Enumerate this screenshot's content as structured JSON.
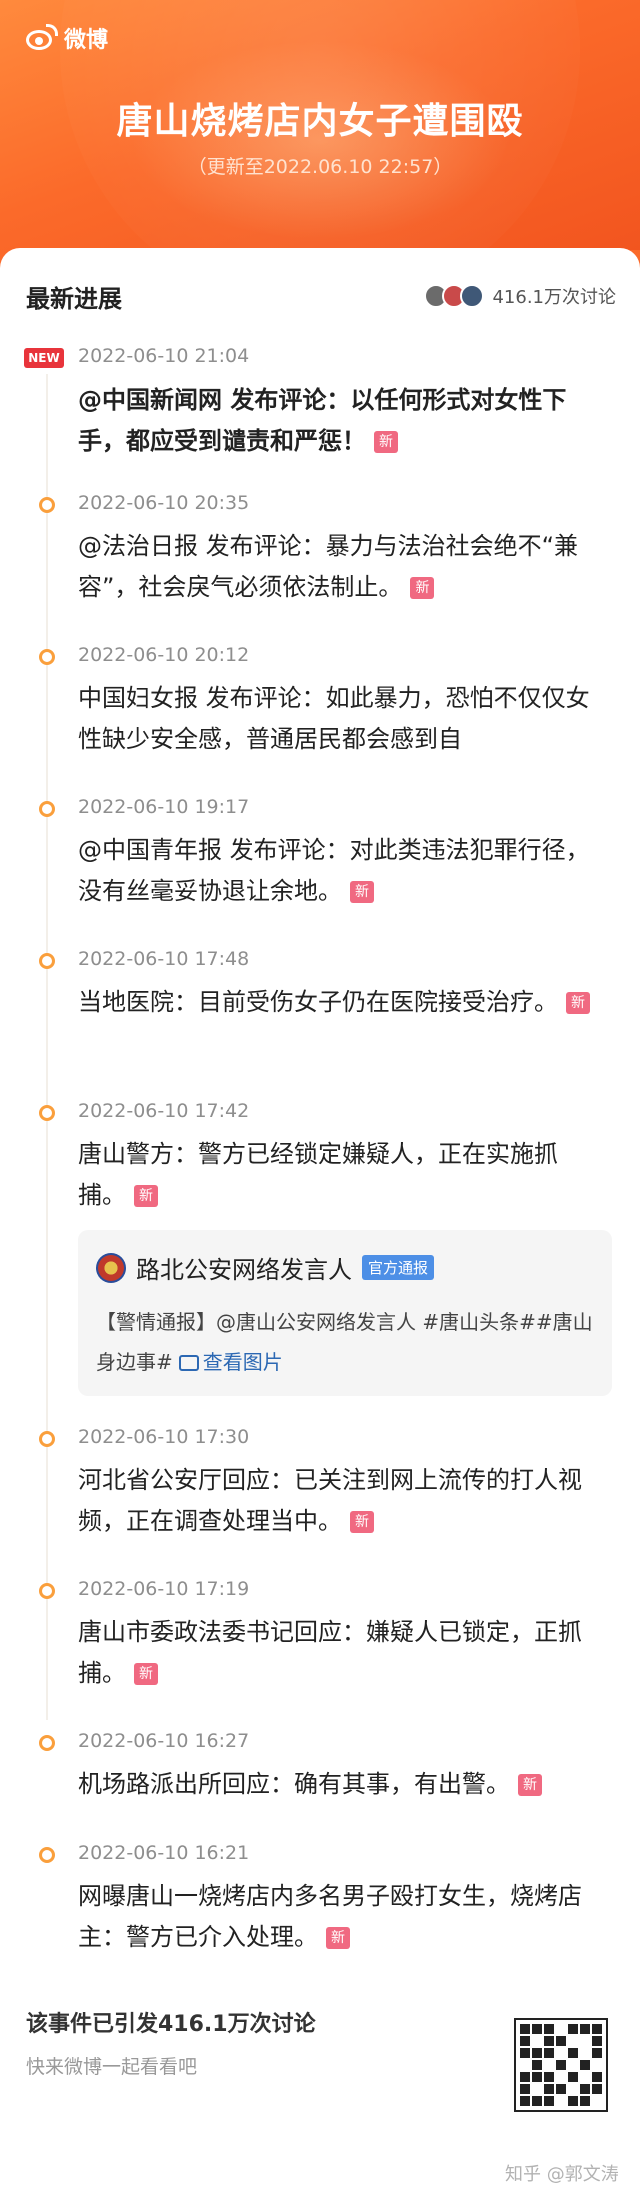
{
  "header": {
    "brand": "微博",
    "title": "唐山烧烤店内女子遭围殴",
    "updated": "（更新至2022.06.10 22:57）"
  },
  "card": {
    "title": "最新进展",
    "discussion_count": "416.1万次讨论"
  },
  "badges": {
    "new_tag": "NEW",
    "xin": "新"
  },
  "timeline": [
    {
      "time": "2022-06-10 21:04",
      "text": "@中国新闻网 发布评论：以任何形式对女性下手，都应受到谴责和严惩！",
      "is_new": true,
      "bold": true
    },
    {
      "time": "2022-06-10 20:35",
      "text": "@法治日报 发布评论：暴力与法治社会绝不“兼容”，社会戾气必须依法制止。"
    },
    {
      "time": "2022-06-10 20:12",
      "text": "  中国妇女报 发布评论：如此暴力，恐怕不仅仅女性缺少安全感，普通居民都会感到自"
    },
    {
      "time": "2022-06-10 19:17",
      "text": "@中国青年报 发布评论：对此类违法犯罪行径，没有丝毫妥协退让余地。"
    },
    {
      "time": "2022-06-10 17:48",
      "text": "当地医院：目前受伤女子仍在医院接受治疗。"
    },
    {
      "time": "2022-06-10 17:42",
      "text": "唐山警方：警方已经锁定嫌疑人，正在实施抓捕。"
    },
    {
      "time": "2022-06-10 17:30",
      "text": "河北省公安厅回应：已关注到网上流传的打人视频，正在调查处理当中。"
    },
    {
      "time": "2022-06-10 17:19",
      "text": "唐山市委政法委书记回应：嫌疑人已锁定，正抓捕。"
    },
    {
      "time": "2022-06-10 16:27",
      "text": "机场路派出所回应：确有其事，有出警。"
    },
    {
      "time": "2022-06-10 16:21",
      "text": "网曝唐山一烧烤店内多名男子殴打女生，烧烤店主：警方已介入处理。"
    }
  ],
  "quote": {
    "name": "路北公安网络发言人",
    "badge": "官方通报",
    "body": "【警情通报】@唐山公安网络发言人 #唐山头条##唐山身边事#",
    "link": "查看图片"
  },
  "footer": {
    "title": "该事件已引发416.1万次讨论",
    "subtitle": "快来微博一起看看吧"
  },
  "watermark": "知乎 @郭文涛",
  "colors": {
    "accent": "#fb6a2a",
    "dot": "#fa9f3c",
    "new_tag": "#e8343b",
    "xin": "#f06981"
  }
}
